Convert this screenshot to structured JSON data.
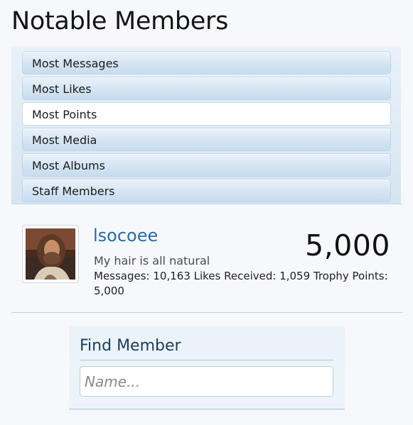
{
  "page": {
    "title": "Notable Members"
  },
  "tabs": [
    {
      "label": "Most Messages",
      "active": false
    },
    {
      "label": "Most Likes",
      "active": false
    },
    {
      "label": "Most Points",
      "active": true
    },
    {
      "label": "Most Media",
      "active": false
    },
    {
      "label": "Most Albums",
      "active": false
    },
    {
      "label": "Staff Members",
      "active": false
    }
  ],
  "member": {
    "username": "lsocoee",
    "score": "5,000",
    "user_title": "My hair is all natural",
    "stats": "Messages: 10,163 Likes Received: 1,059 Trophy Points: 5,000"
  },
  "find_member": {
    "heading": "Find Member",
    "placeholder": "Name..."
  },
  "colors": {
    "username": "#2c6a9f",
    "tab_gradient_top": "#eaf2fa",
    "tab_gradient_bottom": "#c7dcee",
    "divider": "#bed8dc"
  }
}
